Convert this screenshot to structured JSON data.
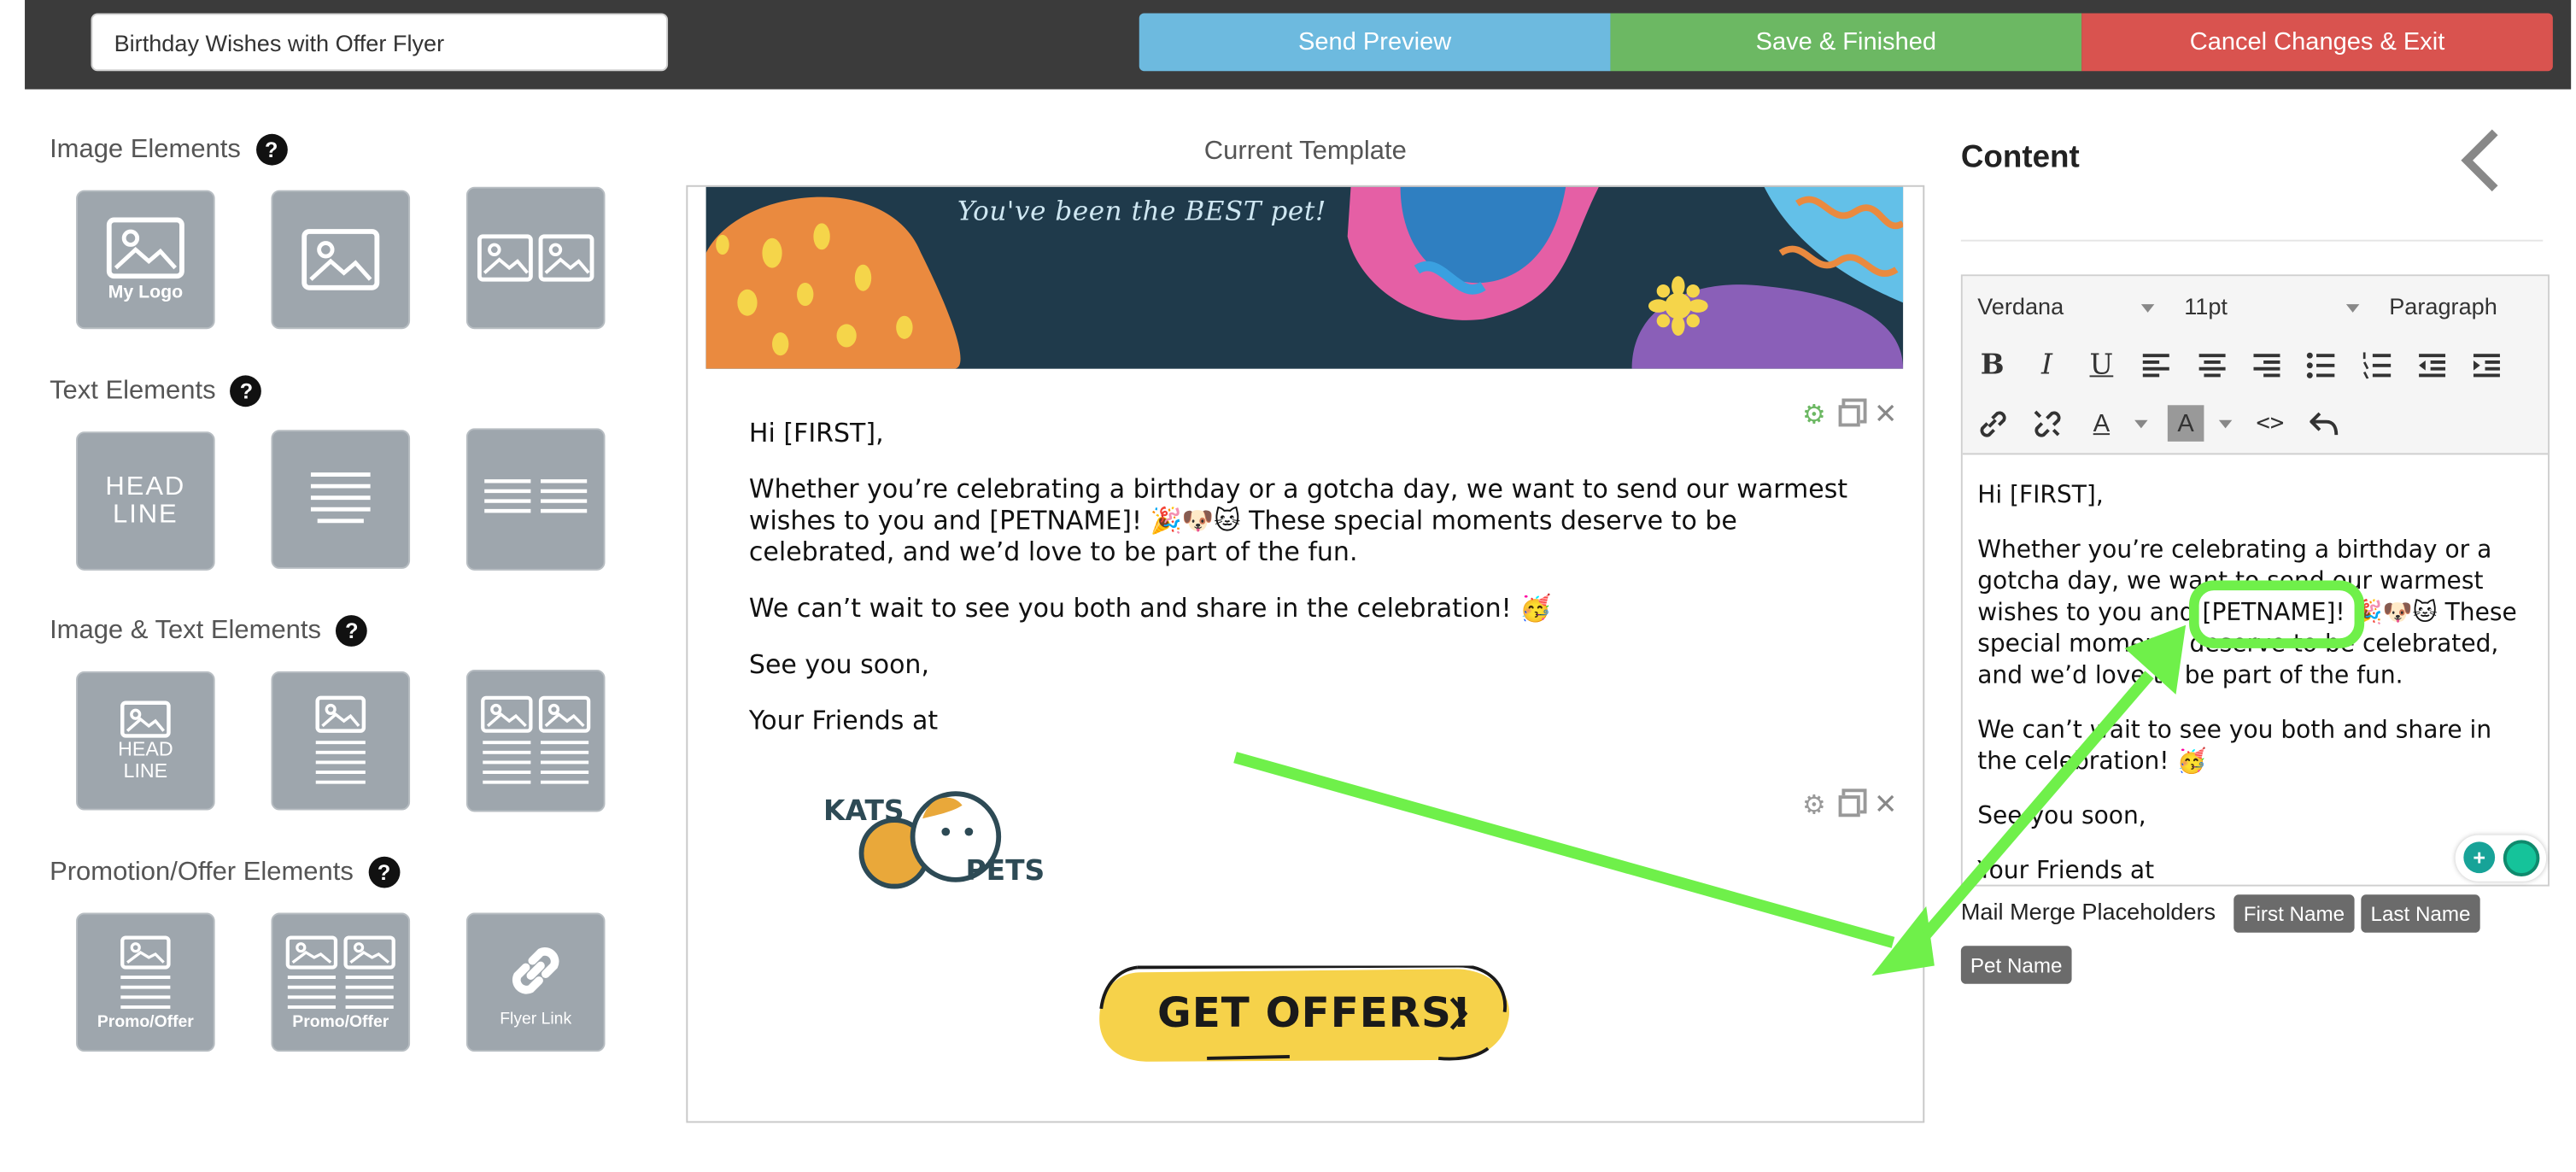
{
  "header": {
    "template_name": "Birthday Wishes with Offer Flyer",
    "send_preview": "Send Preview",
    "save_finished": "Save & Finished",
    "cancel_exit": "Cancel Changes & Exit"
  },
  "palette": {
    "help_glyph": "?",
    "sections": [
      {
        "title": "Image Elements",
        "tiles": [
          "My Logo",
          "",
          ""
        ]
      },
      {
        "title": "Text Elements",
        "tiles": [
          "HEAD LINE",
          "",
          ""
        ]
      },
      {
        "title": "Image & Text Elements",
        "tiles": [
          "HEAD LINE",
          "",
          ""
        ]
      },
      {
        "title": "Promotion/Offer Elements",
        "tiles": [
          "Promo/Offer",
          "Promo/Offer",
          "Flyer Link"
        ]
      }
    ],
    "headline_line1": "HEAD",
    "headline_line2": "LINE"
  },
  "template": {
    "title": "Current Template",
    "banner_text": "You've been the BEST pet!",
    "body": {
      "greeting": "Hi [FIRST],",
      "paragraph1": "Whether you’re celebrating a birthday or a gotcha day, we want to send our warmest wishes to you and [PETNAME]! 🎉🐶🐱 These special moments deserve to be celebrated, and we’d love to be part of the fun.",
      "paragraph2": "We can’t wait to see you both and share in the celebration! 🥳",
      "signoff": "See you soon,",
      "closing": "Your Friends at"
    },
    "logo_word1": "KATS",
    "logo_word2": "PETS",
    "offer_button": "GET OFFERS!"
  },
  "content_panel": {
    "title": "Content",
    "font_family": "Verdana",
    "font_size": "11pt",
    "block_format": "Paragraph",
    "editor": {
      "greeting": "Hi [FIRST],",
      "p1_before": "Whether you’re celebrating a birthday or a gotcha day, we want to send our warmest wishes to you and ",
      "p1_placeholder": "[PETNAME]",
      "p1_after": "! 🎉🐶🐱 These special moments deserve to be celebrated, and we’d love to be part of the fun.",
      "paragraph2": "We can’t wait to see you both and share in the celebration! 🥳",
      "signoff": "See you soon,",
      "closing": "Your Friends at"
    },
    "mail_merge_label": "Mail Merge Placeholders",
    "placeholders": [
      "First Name",
      "Last Name",
      "Pet Name"
    ]
  },
  "colors": {
    "topbar": "#3b3b3b",
    "preview": "#6dbadf",
    "save": "#6cb863",
    "cancel": "#d9534f",
    "annotation": "#6ff04a",
    "tile": "#9ea6ad",
    "chip": "#6b6b6b"
  }
}
